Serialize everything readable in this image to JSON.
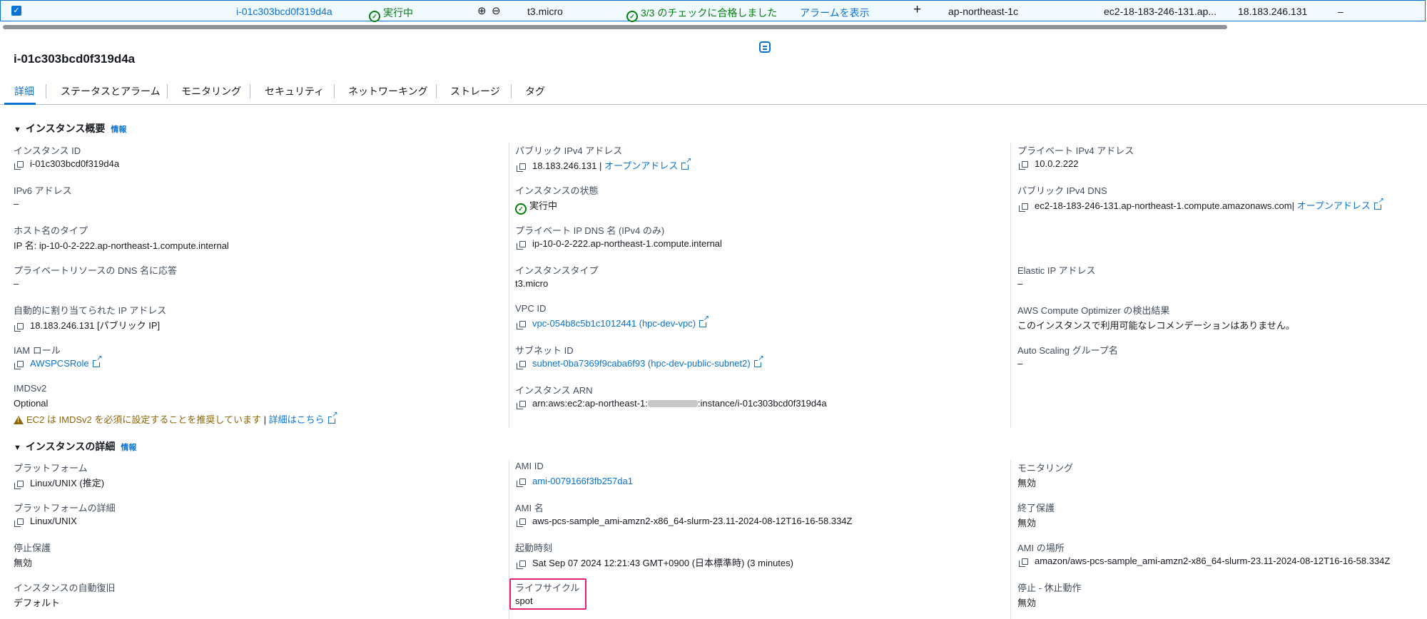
{
  "table_row": {
    "instance_id": "i-01c303bcd0f319d4a",
    "state": "実行中",
    "instance_type": "t3.micro",
    "status_check": "3/3 のチェックに合格しました",
    "alarm": "アラームを表示",
    "az": "ap-northeast-1c",
    "public_dns": "ec2-18-183-246-131.ap...",
    "public_ip": "18.183.246.131",
    "elastic_ip": "–"
  },
  "panel": {
    "title": "i-01c303bcd0f319d4a",
    "tabs": [
      "詳細",
      "ステータスとアラーム",
      "モニタリング",
      "セキュリティ",
      "ネットワーキング",
      "ストレージ",
      "タグ"
    ]
  },
  "summary": {
    "heading": "インスタンス概要",
    "info": "情報",
    "col1": {
      "instance_id_label": "インスタンス ID",
      "instance_id": "i-01c303bcd0f319d4a",
      "ipv6_label": "IPv6 アドレス",
      "ipv6": "–",
      "hostname_type_label": "ホスト名のタイプ",
      "hostname_type": "IP 名: ip-10-0-2-222.ap-northeast-1.compute.internal",
      "private_dns_answer_label": "プライベートリソースの DNS 名に応答",
      "private_dns_answer": "–",
      "auto_ip_label": "自動的に割り当てられた IP アドレス",
      "auto_ip": "18.183.246.131 [パブリック IP]",
      "iam_role_label": "IAM ロール",
      "iam_role": "AWSPCSRole",
      "imdsv2_label": "IMDSv2",
      "imdsv2": "Optional",
      "imdsv2_warning": "EC2 は IMDSv2 を必須に設定することを推奨しています",
      "learn_more": "詳細はこちら"
    },
    "col2": {
      "public_ipv4_label": "パブリック IPv4 アドレス",
      "public_ipv4": "18.183.246.131",
      "open_address": "オープンアドレス",
      "state_label": "インスタンスの状態",
      "state": "実行中",
      "private_ip_dns_label": "プライベート IP DNS 名 (IPv4 のみ)",
      "private_ip_dns": "ip-10-0-2-222.ap-northeast-1.compute.internal",
      "instance_type_label": "インスタンスタイプ",
      "instance_type": "t3.micro",
      "vpc_label": "VPC ID",
      "vpc": "vpc-054b8c5b1c1012441 (hpc-dev-vpc)",
      "subnet_label": "サブネット ID",
      "subnet": "subnet-0ba7369f9caba6f93 (hpc-dev-public-subnet2)",
      "arn_label": "インスタンス ARN",
      "arn_prefix": "arn:aws:ec2:ap-northeast-1:",
      "arn_suffix": ":instance/i-01c303bcd0f319d4a"
    },
    "col3": {
      "private_ipv4_label": "プライベート IPv4 アドレス",
      "private_ipv4": "10.0.2.222",
      "public_dns_label": "パブリック IPv4 DNS",
      "public_dns": "ec2-18-183-246-131.ap-northeast-1.compute.amazonaws.com",
      "open_address": "オープンアドレス",
      "elastic_ip_label": "Elastic IP アドレス",
      "elastic_ip": "–",
      "optimizer_label": "AWS Compute Optimizer の検出結果",
      "optimizer": "このインスタンスで利用可能なレコメンデーションはありません。",
      "asg_label": "Auto Scaling グループ名",
      "asg": "–"
    }
  },
  "details": {
    "heading": "インスタンスの詳細",
    "info": "情報",
    "col1": {
      "platform_label": "プラットフォーム",
      "platform": "Linux/UNIX (推定)",
      "platform_details_label": "プラットフォームの詳細",
      "platform_details": "Linux/UNIX",
      "stop_protection_label": "停止保護",
      "stop_protection": "無効",
      "auto_recovery_label": "インスタンスの自動復旧",
      "auto_recovery": "デフォルト"
    },
    "col2": {
      "ami_id_label": "AMI ID",
      "ami_id": "ami-0079166f3fb257da1",
      "ami_name_label": "AMI 名",
      "ami_name": "aws-pcs-sample_ami-amzn2-x86_64-slurm-23.11-2024-08-12T16-16-58.334Z",
      "launch_time_label": "起動時刻",
      "launch_time": "Sat Sep 07 2024 12:21:43 GMT+0900 (日本標準時) (3 minutes)",
      "lifecycle_label": "ライフサイクル",
      "lifecycle": "spot"
    },
    "col3": {
      "monitoring_label": "モニタリング",
      "monitoring": "無効",
      "termination_protection_label": "終了保護",
      "termination_protection": "無効",
      "ami_location_label": "AMI の場所",
      "ami_location": "amazon/aws-pcs-sample_ami-amzn2-x86_64-slurm-23.11-2024-08-12T16-16-58.334Z",
      "stop_hibernate_label": "停止 - 休止動作",
      "stop_hibernate": "無効"
    }
  },
  "colors": {
    "link": "#0972d3",
    "success": "#037f0c",
    "warning": "#8d6605",
    "highlight": "#e0217a"
  }
}
